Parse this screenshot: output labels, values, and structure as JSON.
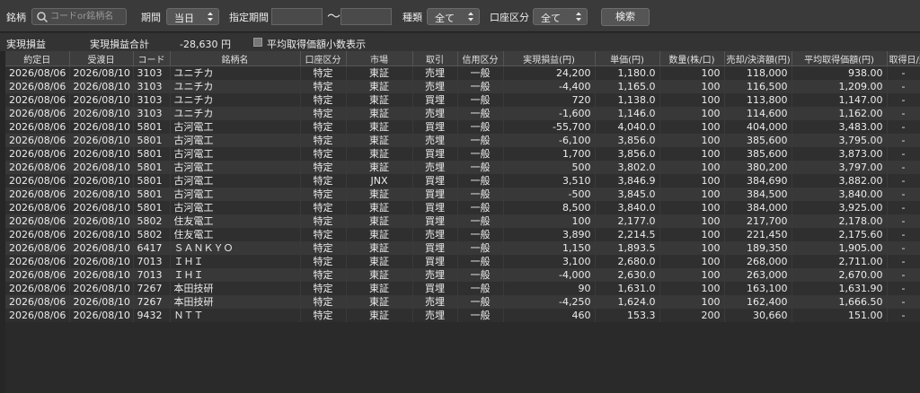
{
  "toolbar": {
    "brand_label": "銘柄",
    "search_placeholder": "コードor銘柄名",
    "period_label": "期間",
    "period_value": "当日",
    "specified_period_label": "指定期間",
    "tilde": "〜",
    "type_label": "種類",
    "type_value": "全て",
    "account_label": "口座区分",
    "account_value": "全て",
    "search_button": "検索"
  },
  "summary": {
    "label": "実現損益",
    "total_label": "実現損益合計",
    "total_value": "-28,630 円",
    "checkbox_label": "平均取得価額小数表示"
  },
  "table": {
    "headers": [
      "約定日",
      "受渡日",
      "コード",
      "銘柄名",
      "口座区分",
      "市場",
      "取引",
      "信用区分",
      "実現損益(円)",
      "単価(円)",
      "数量(株/口)",
      "売却/決済額(円)",
      "平均取得価額(円)",
      "取得日/建日"
    ],
    "rows": [
      [
        "2026/08/06",
        "2026/08/10",
        "3103",
        "ユニチカ",
        "特定",
        "東証",
        "売埋",
        "一般",
        "24,200",
        "1,180.0",
        "100",
        "118,000",
        "938.00",
        "-"
      ],
      [
        "2026/08/06",
        "2026/08/10",
        "3103",
        "ユニチカ",
        "特定",
        "東証",
        "売埋",
        "一般",
        "-4,400",
        "1,165.0",
        "100",
        "116,500",
        "1,209.00",
        "-"
      ],
      [
        "2026/08/06",
        "2026/08/10",
        "3103",
        "ユニチカ",
        "特定",
        "東証",
        "買埋",
        "一般",
        "720",
        "1,138.0",
        "100",
        "113,800",
        "1,147.00",
        "-"
      ],
      [
        "2026/08/06",
        "2026/08/10",
        "3103",
        "ユニチカ",
        "特定",
        "東証",
        "売埋",
        "一般",
        "-1,600",
        "1,146.0",
        "100",
        "114,600",
        "1,162.00",
        "-"
      ],
      [
        "2026/08/06",
        "2026/08/10",
        "5801",
        "古河電工",
        "特定",
        "東証",
        "買埋",
        "一般",
        "-55,700",
        "4,040.0",
        "100",
        "404,000",
        "3,483.00",
        "-"
      ],
      [
        "2026/08/06",
        "2026/08/10",
        "5801",
        "古河電工",
        "特定",
        "東証",
        "売埋",
        "一般",
        "-6,100",
        "3,856.0",
        "100",
        "385,600",
        "3,795.00",
        "-"
      ],
      [
        "2026/08/06",
        "2026/08/10",
        "5801",
        "古河電工",
        "特定",
        "東証",
        "買埋",
        "一般",
        "1,700",
        "3,856.0",
        "100",
        "385,600",
        "3,873.00",
        "-"
      ],
      [
        "2026/08/06",
        "2026/08/10",
        "5801",
        "古河電工",
        "特定",
        "東証",
        "売埋",
        "一般",
        "500",
        "3,802.0",
        "100",
        "380,200",
        "3,797.00",
        "-"
      ],
      [
        "2026/08/06",
        "2026/08/10",
        "5801",
        "古河電工",
        "特定",
        "JNX",
        "買埋",
        "一般",
        "3,510",
        "3,846.9",
        "100",
        "384,690",
        "3,882.00",
        "-"
      ],
      [
        "2026/08/06",
        "2026/08/10",
        "5801",
        "古河電工",
        "特定",
        "東証",
        "買埋",
        "一般",
        "-500",
        "3,845.0",
        "100",
        "384,500",
        "3,840.00",
        "-"
      ],
      [
        "2026/08/06",
        "2026/08/10",
        "5801",
        "古河電工",
        "特定",
        "東証",
        "買埋",
        "一般",
        "8,500",
        "3,840.0",
        "100",
        "384,000",
        "3,925.00",
        "-"
      ],
      [
        "2026/08/06",
        "2026/08/10",
        "5802",
        "住友電工",
        "特定",
        "東証",
        "買埋",
        "一般",
        "100",
        "2,177.0",
        "100",
        "217,700",
        "2,178.00",
        "-"
      ],
      [
        "2026/08/06",
        "2026/08/10",
        "5802",
        "住友電工",
        "特定",
        "東証",
        "売埋",
        "一般",
        "3,890",
        "2,214.5",
        "100",
        "221,450",
        "2,175.60",
        "-"
      ],
      [
        "2026/08/06",
        "2026/08/10",
        "6417",
        "ＳＡＮＫＹＯ",
        "特定",
        "東証",
        "買埋",
        "一般",
        "1,150",
        "1,893.5",
        "100",
        "189,350",
        "1,905.00",
        "-"
      ],
      [
        "2026/08/06",
        "2026/08/10",
        "7013",
        "ＩＨＩ",
        "特定",
        "東証",
        "買埋",
        "一般",
        "3,100",
        "2,680.0",
        "100",
        "268,000",
        "2,711.00",
        "-"
      ],
      [
        "2026/08/06",
        "2026/08/10",
        "7013",
        "ＩＨＩ",
        "特定",
        "東証",
        "売埋",
        "一般",
        "-4,000",
        "2,630.0",
        "100",
        "263,000",
        "2,670.00",
        "-"
      ],
      [
        "2026/08/06",
        "2026/08/10",
        "7267",
        "本田技研",
        "特定",
        "東証",
        "買埋",
        "一般",
        "90",
        "1,631.0",
        "100",
        "163,100",
        "1,631.90",
        "-"
      ],
      [
        "2026/08/06",
        "2026/08/10",
        "7267",
        "本田技研",
        "特定",
        "東証",
        "売埋",
        "一般",
        "-4,250",
        "1,624.0",
        "100",
        "162,400",
        "1,666.50",
        "-"
      ],
      [
        "2026/08/06",
        "2026/08/10",
        "9432",
        "ＮＴＴ",
        "特定",
        "東証",
        "売埋",
        "一般",
        "460",
        "153.3",
        "200",
        "30,660",
        "151.00",
        "-"
      ]
    ]
  }
}
